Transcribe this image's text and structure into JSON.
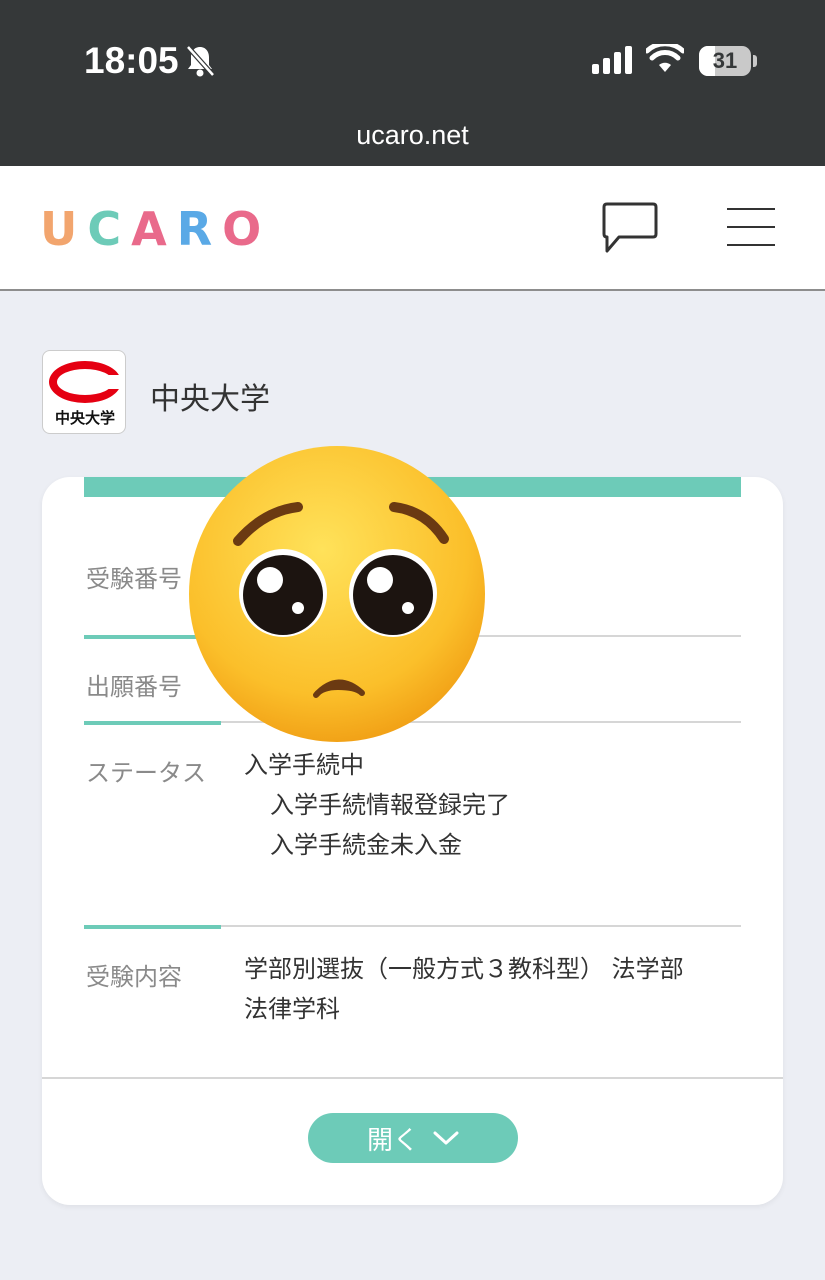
{
  "status_bar": {
    "time": "18:05",
    "battery": "31",
    "url": "ucaro.net",
    "icons": [
      "bell-slash-icon",
      "signal-icon",
      "wifi-icon",
      "battery-icon"
    ]
  },
  "header": {
    "logo": [
      "U",
      "C",
      "A",
      "R",
      "O"
    ],
    "logo_colors": [
      "#f2a56e",
      "#6dcbb8",
      "#e96a8b",
      "#5aa9e6",
      "#e96a8b"
    ],
    "icons": [
      "chat-icon",
      "menu-icon"
    ]
  },
  "university": {
    "logo_text": "中央大学",
    "name": "中央大学"
  },
  "card": {
    "rows": [
      {
        "label": "受験番号",
        "values": []
      },
      {
        "label": "出願番号",
        "values": []
      },
      {
        "label": "ステータス",
        "values": [
          "入学手続中",
          "入学手続情報登録完了",
          "入学手続金未入金"
        ]
      },
      {
        "label": "受験内容",
        "values": [
          "学部別選抜（一般方式３教科型） 法学部",
          "法律学科"
        ]
      }
    ],
    "open_button": "開く",
    "accent_color": "#6dcbb8"
  },
  "overlay": {
    "emoji": "pleading-face-emoji"
  }
}
